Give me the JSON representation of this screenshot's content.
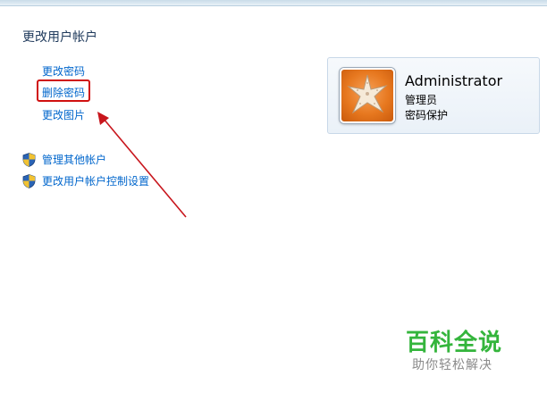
{
  "page": {
    "title": "更改用户帐户"
  },
  "tasks": {
    "change_password": "更改密码",
    "remove_password": "删除密码",
    "change_picture": "更改图片",
    "manage_accounts": "管理其他帐户",
    "uac_settings": "更改用户帐户控制设置"
  },
  "account": {
    "name": "Administrator",
    "type": "管理员",
    "status": "密码保护",
    "avatar_icon": "starfish-picture"
  },
  "watermark": {
    "title": "百科全说",
    "subtitle": "助你轻松解决"
  },
  "colors": {
    "link": "#0066cc",
    "highlight": "#d01010",
    "arrow": "#c8161d",
    "watermark": "#34b53c"
  }
}
